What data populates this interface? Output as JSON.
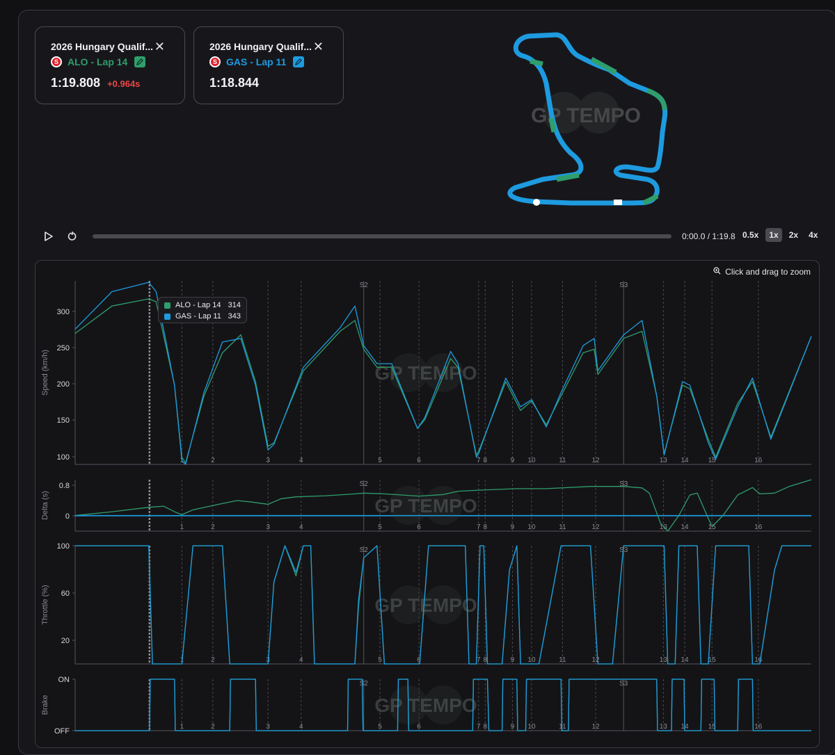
{
  "laps": [
    {
      "title": "2026 Hungary Qualif...",
      "driver_label": "ALO - Lap 14",
      "time": "1:19.808",
      "gap": "+0.964s",
      "color": "#2f9e6c"
    },
    {
      "title": "2026 Hungary Qualif...",
      "driver_label": "GAS - Lap 11",
      "time": "1:18.844",
      "gap": "",
      "color": "#1e9be0"
    }
  ],
  "playback": {
    "time_label": "0:00.0 / 1:19.8",
    "progress": 0.0,
    "speeds": [
      "0.5x",
      "1x",
      "2x",
      "4x"
    ],
    "active_speed": "1x"
  },
  "zoom_hint": "Click and drag to zoom",
  "watermark": "GP TEMPO",
  "tooltip": {
    "rows": [
      {
        "label": "ALO - Lap 14",
        "value": "314",
        "color": "#2f9e6c"
      },
      {
        "label": "GAS - Lap 11",
        "value": "343",
        "color": "#1e9be0"
      }
    ]
  },
  "corners": [
    "1",
    "2",
    "3",
    "4",
    "5",
    "6",
    "7",
    "8",
    "9",
    "10",
    "11",
    "12",
    "13",
    "14",
    "15",
    "16"
  ],
  "sectors": [
    "S2",
    "S3"
  ],
  "colors": {
    "alo": "#2f9e6c",
    "gas": "#1e9be0",
    "grid": "#2b2b30"
  },
  "chart_data": [
    {
      "type": "line",
      "ylabel": "Speed (km/h)",
      "yticks": [
        "100",
        "150",
        "200",
        "250",
        "300"
      ],
      "ylim": [
        90,
        345
      ],
      "x_markers": {
        "corners": [
          "1",
          "2",
          "3",
          "4",
          "5",
          "6",
          "7",
          "8",
          "9",
          "10",
          "11",
          "12",
          "13",
          "14",
          "15",
          "16"
        ],
        "corner_pos": [
          0.145,
          0.187,
          0.262,
          0.307,
          0.414,
          0.467,
          0.548,
          0.557,
          0.594,
          0.62,
          0.662,
          0.707,
          0.799,
          0.828,
          0.865,
          0.928
        ],
        "sectors": [
          "S2",
          "S3"
        ],
        "sector_pos": [
          0.392,
          0.745
        ],
        "cursor_pos": 0.101
      },
      "x": [
        0,
        0.05,
        0.1,
        0.11,
        0.135,
        0.145,
        0.15,
        0.175,
        0.2,
        0.225,
        0.245,
        0.262,
        0.27,
        0.31,
        0.36,
        0.38,
        0.392,
        0.41,
        0.43,
        0.465,
        0.475,
        0.51,
        0.52,
        0.545,
        0.548,
        0.585,
        0.605,
        0.62,
        0.64,
        0.66,
        0.69,
        0.705,
        0.71,
        0.745,
        0.77,
        0.79,
        0.8,
        0.825,
        0.835,
        0.86,
        0.87,
        0.9,
        0.92,
        0.945,
        1.0
      ],
      "series": [
        {
          "name": "ALO - Lap 14",
          "values": [
            272,
            310,
            320,
            316,
            200,
            100,
            92,
            185,
            245,
            270,
            205,
            115,
            120,
            220,
            275,
            290,
            250,
            225,
            225,
            140,
            152,
            237,
            225,
            103,
            108,
            205,
            165,
            178,
            145,
            185,
            245,
            250,
            215,
            265,
            275,
            185,
            105,
            200,
            195,
            125,
            100,
            175,
            205,
            128,
            268
          ]
        },
        {
          "name": "GAS - Lap 11",
          "values": [
            278,
            330,
            343,
            330,
            200,
            95,
            90,
            190,
            260,
            265,
            200,
            110,
            118,
            225,
            280,
            310,
            255,
            230,
            230,
            140,
            155,
            247,
            230,
            100,
            105,
            210,
            170,
            180,
            142,
            190,
            255,
            265,
            220,
            270,
            290,
            185,
            103,
            205,
            200,
            120,
            97,
            170,
            210,
            125,
            268
          ]
        }
      ]
    },
    {
      "type": "line",
      "ylabel": "Delta (s)",
      "yticks": [
        "0",
        "0.8"
      ],
      "ylim": [
        -0.42,
        0.96
      ],
      "x": [
        0,
        0.05,
        0.1,
        0.12,
        0.135,
        0.145,
        0.16,
        0.2,
        0.22,
        0.24,
        0.262,
        0.28,
        0.3,
        0.34,
        0.38,
        0.392,
        0.42,
        0.467,
        0.5,
        0.52,
        0.55,
        0.6,
        0.64,
        0.7,
        0.745,
        0.77,
        0.78,
        0.795,
        0.805,
        0.82,
        0.835,
        0.845,
        0.865,
        0.88,
        0.9,
        0.92,
        0.93,
        0.95,
        0.97,
        1.0
      ],
      "series": [
        {
          "name": "ALO - Lap 14",
          "values": [
            0,
            0.1,
            0.22,
            0.25,
            0.1,
            0.02,
            0.15,
            0.32,
            0.4,
            0.36,
            0.3,
            0.45,
            0.5,
            0.53,
            0.58,
            0.6,
            0.58,
            0.52,
            0.56,
            0.65,
            0.68,
            0.72,
            0.72,
            0.78,
            0.78,
            0.74,
            0.6,
            -0.2,
            -0.42,
            0.0,
            0.55,
            0.6,
            -0.3,
            0.0,
            0.55,
            0.75,
            0.58,
            0.6,
            0.78,
            0.96
          ]
        },
        {
          "name": "GAS - Lap 11",
          "values": [
            0,
            0,
            0,
            0,
            0,
            0,
            0,
            0,
            0,
            0,
            0,
            0,
            0,
            0,
            0,
            0,
            0,
            0,
            0,
            0,
            0,
            0,
            0,
            0,
            0,
            0,
            0,
            0,
            0,
            0,
            0,
            0,
            0,
            0,
            0,
            0,
            0,
            0,
            0,
            0
          ]
        }
      ]
    },
    {
      "type": "line",
      "ylabel": "Throttle (%)",
      "yticks": [
        "20",
        "60",
        "100"
      ],
      "ylim": [
        2,
        100
      ],
      "x": [
        0,
        0.1,
        0.105,
        0.11,
        0.14,
        0.145,
        0.16,
        0.2,
        0.21,
        0.25,
        0.255,
        0.262,
        0.27,
        0.285,
        0.3,
        0.31,
        0.32,
        0.325,
        0.38,
        0.385,
        0.392,
        0.41,
        0.42,
        0.46,
        0.465,
        0.468,
        0.48,
        0.53,
        0.535,
        0.545,
        0.55,
        0.555,
        0.56,
        0.58,
        0.59,
        0.6,
        0.605,
        0.62,
        0.63,
        0.66,
        0.67,
        0.7,
        0.71,
        0.73,
        0.745,
        0.8,
        0.805,
        0.815,
        0.82,
        0.845,
        0.85,
        0.86,
        0.87,
        0.915,
        0.92,
        0.93,
        0.95,
        0.96,
        1.0
      ],
      "series": [
        {
          "name": "ALO - Lap 14",
          "values": [
            100,
            100,
            0,
            0,
            0,
            0,
            100,
            100,
            0,
            0,
            0,
            0,
            70,
            100,
            75,
            100,
            100,
            0,
            0,
            50,
            90,
            100,
            0,
            0,
            0,
            0,
            100,
            100,
            0,
            0,
            100,
            100,
            0,
            0,
            80,
            100,
            0,
            0,
            0,
            100,
            100,
            100,
            0,
            0,
            100,
            100,
            0,
            0,
            100,
            100,
            0,
            0,
            100,
            100,
            0,
            0,
            80,
            100,
            100
          ]
        },
        {
          "name": "GAS - Lap 11",
          "values": [
            100,
            100,
            0,
            0,
            0,
            0,
            100,
            100,
            0,
            0,
            0,
            0,
            70,
            100,
            78,
            100,
            100,
            0,
            0,
            55,
            90,
            100,
            0,
            0,
            0,
            0,
            100,
            100,
            0,
            0,
            100,
            100,
            0,
            0,
            80,
            100,
            0,
            0,
            0,
            100,
            100,
            100,
            0,
            0,
            100,
            100,
            0,
            0,
            100,
            100,
            0,
            0,
            100,
            100,
            0,
            0,
            80,
            100,
            100
          ]
        }
      ]
    },
    {
      "type": "line",
      "ylabel": "Brake",
      "yticks": [
        "OFF",
        "ON"
      ],
      "ylim": [
        0,
        1
      ],
      "x": [
        0,
        0.101,
        0.102,
        0.135,
        0.136,
        0.21,
        0.211,
        0.245,
        0.246,
        0.37,
        0.371,
        0.39,
        0.391,
        0.438,
        0.439,
        0.452,
        0.453,
        0.54,
        0.541,
        0.56,
        0.562,
        0.58,
        0.581,
        0.6,
        0.601,
        0.612,
        0.613,
        0.66,
        0.661,
        0.67,
        0.671,
        0.79,
        0.791,
        0.81,
        0.811,
        0.827,
        0.828,
        0.85,
        0.851,
        0.868,
        0.869,
        0.9,
        0.901,
        0.92,
        0.921,
        1.0
      ],
      "series": [
        {
          "name": "ALO - Lap 14",
          "values": [
            0,
            0,
            1,
            1,
            0,
            0,
            1,
            1,
            0,
            0,
            1,
            1,
            0,
            0,
            1,
            1,
            0,
            0,
            1,
            1,
            0,
            0,
            1,
            1,
            0,
            0,
            1,
            1,
            0,
            0,
            1,
            1,
            0,
            0,
            1,
            1,
            0,
            0,
            1,
            1,
            0,
            0,
            1,
            1,
            0,
            0
          ]
        },
        {
          "name": "GAS - Lap 11",
          "values": [
            0,
            0,
            1,
            1,
            0,
            0,
            1,
            1,
            0,
            0,
            1,
            1,
            0,
            0,
            1,
            1,
            0,
            0,
            1,
            1,
            0,
            0,
            1,
            1,
            0,
            0,
            1,
            1,
            0,
            0,
            1,
            1,
            0,
            0,
            1,
            1,
            0,
            0,
            1,
            1,
            0,
            0,
            1,
            1,
            0,
            0
          ]
        }
      ]
    }
  ]
}
